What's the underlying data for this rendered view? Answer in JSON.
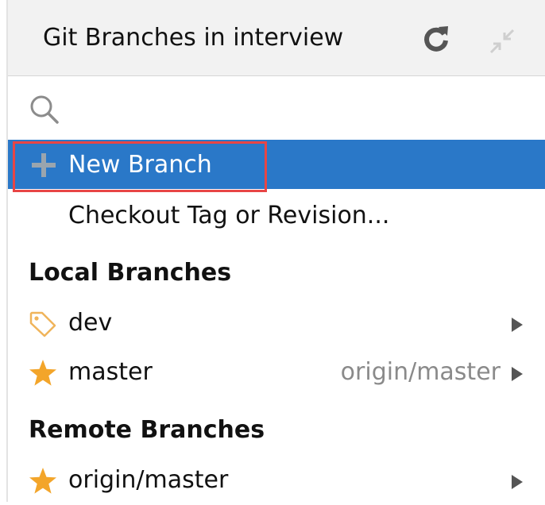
{
  "header": {
    "title": "Git Branches in interview",
    "refresh_icon": "refresh-icon",
    "collapse_icon": "collapse-icon"
  },
  "search": {
    "value": "",
    "placeholder": "",
    "icon": "search-icon"
  },
  "actions": {
    "new_branch": "New Branch",
    "checkout": "Checkout Tag or Revision..."
  },
  "local": {
    "title": "Local Branches",
    "branches": [
      {
        "name": "dev",
        "icon": "tag-icon",
        "tracking": ""
      },
      {
        "name": "master",
        "icon": "star-icon",
        "tracking": "origin/master"
      }
    ]
  },
  "remote": {
    "title": "Remote Branches",
    "branches": [
      {
        "name": "origin/master",
        "icon": "star-icon"
      }
    ]
  },
  "colors": {
    "selection": "#2a78c8",
    "highlight_border": "#e84545",
    "star": "#f3a52a",
    "tag": "#f0b45a",
    "muted_text": "#8a8a8a"
  }
}
